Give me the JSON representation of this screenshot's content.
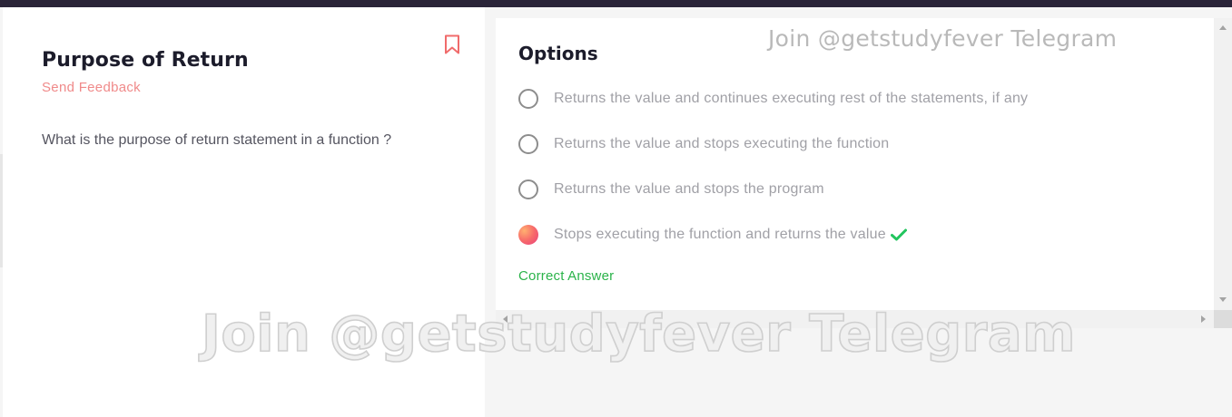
{
  "question": {
    "title": "Purpose of Return",
    "feedback_label": "Send Feedback",
    "text": "What is the purpose of return statement in a function ?"
  },
  "options": {
    "heading": "Options",
    "items": [
      {
        "label": "Returns the value and continues executing rest of the statements, if any",
        "selected": false
      },
      {
        "label": "Returns the value and stops executing the function",
        "selected": false
      },
      {
        "label": "Returns the value and stops the program",
        "selected": false
      },
      {
        "label": "Stops executing the function and returns the value",
        "selected": true,
        "marked_correct": true
      }
    ],
    "result_label": "Correct Answer"
  },
  "watermark": {
    "text": "Join @getstudyfever Telegram"
  },
  "colors": {
    "topbar": "#2a2438",
    "feedback": "#f08a8a",
    "bookmark": "#f06b6b",
    "correct": "#2bb34a",
    "check": "#22c55e"
  },
  "icons": {
    "bookmark": "bookmark-outline-icon",
    "check": "checkmark-icon"
  }
}
